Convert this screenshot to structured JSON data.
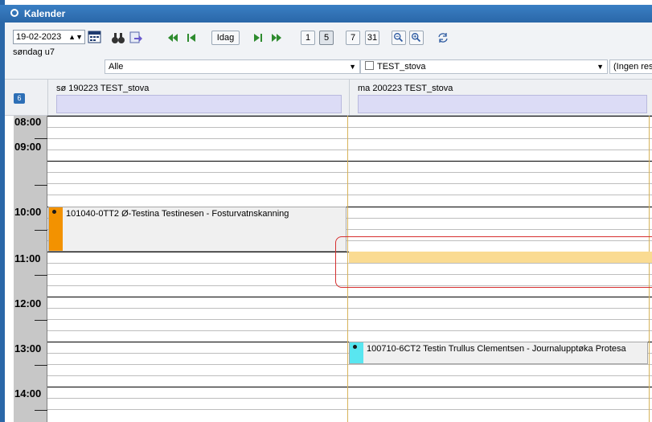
{
  "window": {
    "title": "Kalender",
    "title_icon": "calendar-plus-icon"
  },
  "toolbar": {
    "date_value": "19-02-2023",
    "week_label": "søndag u7",
    "today_label": "Idag",
    "view_buttons": [
      "1",
      "5",
      "7",
      "31"
    ],
    "active_view": "5",
    "filter_select": "Alle",
    "resource_select": "TEST_stova",
    "extra_select": "(Ingen res"
  },
  "calendar": {
    "days": [
      {
        "header": "sø 190223 TEST_stova"
      },
      {
        "header": "ma 200223 TEST_stova"
      }
    ],
    "hours": [
      "08:00",
      "09:00",
      "10:00",
      "11:00",
      "12:00",
      "13:00",
      "14:00"
    ],
    "events": [
      {
        "text": "101040-0TT2  Ø-Testina Testinesen - Fosturvatnskanning",
        "color": "#f39200"
      },
      {
        "text": "100710-6CT2  Testin Trullus Clementsen - Journalupptøka Protesa",
        "color": "#59e6f0"
      }
    ],
    "highlight_color": "#fadb92"
  }
}
